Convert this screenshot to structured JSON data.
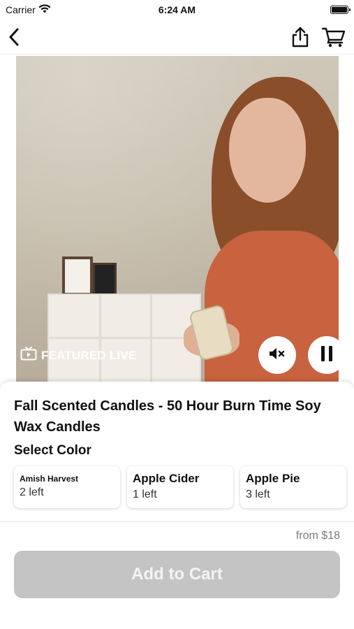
{
  "status_bar": {
    "carrier": "Carrier",
    "time": "6:24 AM",
    "icons": [
      "wifi-icon",
      "battery-icon"
    ]
  },
  "nav": {
    "icons": [
      "back-icon",
      "share-icon",
      "cart-icon"
    ]
  },
  "video": {
    "badge_label": "FEATURED LIVE",
    "badge_icon": "tv-icon",
    "controls": [
      "mute-icon",
      "pause-icon"
    ]
  },
  "product": {
    "title": "Fall Scented Candles - 50 Hour Burn Time Soy Wax Candles",
    "select_label": "Select Color",
    "options": [
      {
        "name": "Amish Harvest",
        "stock": "2 left"
      },
      {
        "name": "Apple Cider",
        "stock": "1 left"
      },
      {
        "name": "Apple Pie",
        "stock": "3 left"
      }
    ]
  },
  "footer": {
    "price": "from $18",
    "add_to_cart": "Add to Cart"
  },
  "colors": {
    "button_disabled": "#c4c4c4",
    "sweater": "#c8623f",
    "text": "#111111"
  }
}
